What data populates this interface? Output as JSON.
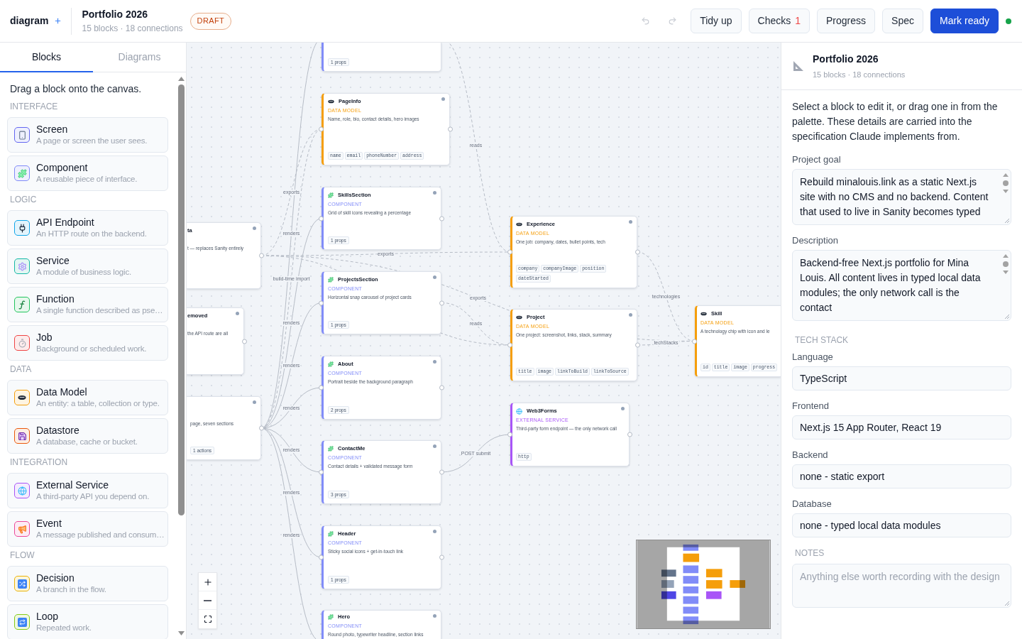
{
  "header": {
    "app": "diagram",
    "title": "Portfolio 2026",
    "subtitle": "15 blocks · 18 connections",
    "status": "DRAFT",
    "undo": {
      "disabled": true
    },
    "redo": {
      "disabled": true
    },
    "actions": [
      {
        "label": "Tidy up",
        "kind": "secondary"
      },
      {
        "label": "Checks",
        "count": "1",
        "kind": "secondary"
      },
      {
        "label": "Progress",
        "kind": "secondary"
      },
      {
        "label": "Spec",
        "kind": "secondary"
      },
      {
        "label": "Mark ready",
        "kind": "primary"
      }
    ],
    "connected": true
  },
  "sidebar": {
    "tabs": [
      {
        "label": "Blocks",
        "selected": true
      },
      {
        "label": "Diagrams",
        "selected": false
      }
    ],
    "hint": "Drag a block onto the canvas.",
    "sections": [
      {
        "label": "INTERFACE",
        "items": [
          {
            "kind": "screen",
            "title": "Screen",
            "description": "A page or screen the user sees."
          },
          {
            "kind": "component",
            "title": "Component",
            "description": "A reusable piece of interface."
          }
        ]
      },
      {
        "label": "LOGIC",
        "items": [
          {
            "kind": "api",
            "title": "API Endpoint",
            "description": "An HTTP route on the backend."
          },
          {
            "kind": "service",
            "title": "Service",
            "description": "A module of business logic."
          },
          {
            "kind": "function",
            "title": "Function",
            "description": "A single function described as pse…"
          },
          {
            "kind": "job",
            "title": "Job",
            "description": "Background or scheduled work."
          }
        ]
      },
      {
        "label": "DATA",
        "items": [
          {
            "kind": "data_model",
            "title": "Data Model",
            "description": "An entity: a table, collection or type."
          },
          {
            "kind": "datastore",
            "title": "Datastore",
            "description": "A database, cache or bucket."
          }
        ]
      },
      {
        "label": "INTEGRATION",
        "items": [
          {
            "kind": "external_service",
            "title": "External Service",
            "description": "A third-party API you depend on."
          },
          {
            "kind": "event",
            "title": "Event",
            "description": "A message published and consum…"
          }
        ]
      },
      {
        "label": "FLOW",
        "items": [
          {
            "kind": "decision",
            "title": "Decision",
            "description": "A branch in the flow."
          },
          {
            "kind": "loop",
            "title": "Loop",
            "description": "Repeated work."
          }
        ]
      }
    ]
  },
  "canvas": {
    "nodes": [
      {
        "kind": "component",
        "tags": [
          "1 props"
        ]
      },
      {
        "kind": "data_model",
        "title": "PageInfo",
        "type_label": "DATA MODEL",
        "description": "Name, role, bio, contact details, hero images",
        "fields": [
          "name",
          "email",
          "phoneNumber",
          "address"
        ]
      },
      {
        "title": "ta",
        "description": "t — replaces Sanity entirely"
      },
      {
        "kind": "component",
        "title": "SkillsSection",
        "type_label": "COMPONENT",
        "description": "Grid of skill icons revealing a percentage",
        "tags": [
          "1 props"
        ]
      },
      {
        "kind": "component",
        "title": "ProjectsSection",
        "type_label": "COMPONENT",
        "description": "Horizontal snap carousel of project cards",
        "tags": [
          "1 props"
        ]
      },
      {
        "title": "emoved",
        "description": "the API route are all"
      },
      {
        "kind": "component",
        "title": "About",
        "type_label": "COMPONENT",
        "description": "Portrait beside the background paragraph",
        "tags": [
          "2 props"
        ]
      },
      {
        "description": "page, seven sections",
        "tags": [
          "1 actions"
        ]
      },
      {
        "kind": "component",
        "title": "ContactMe",
        "type_label": "COMPONENT",
        "description": "Contact details + validated message form",
        "tags": [
          "3 props"
        ]
      },
      {
        "kind": "component",
        "title": "Header",
        "type_label": "COMPONENT",
        "description": "Sticky social icons + get-in-touch link",
        "tags": [
          "1 props"
        ]
      },
      {
        "kind": "component",
        "title": "Hero",
        "type_label": "COMPONENT",
        "description": "Round photo, typewriter headline, section links"
      },
      {
        "kind": "data_model",
        "title": "Experience",
        "type_label": "DATA MODEL",
        "description": "One job: company, dates, bullet points, tech",
        "fields": [
          "company",
          "companyImage",
          "position",
          "dateStarted"
        ]
      },
      {
        "kind": "data_model",
        "title": "Project",
        "type_label": "DATA MODEL",
        "description": "One project: screenshot, links, stack, summary",
        "fields": [
          "title",
          "image",
          "linkToBuild",
          "linkToSource"
        ]
      },
      {
        "kind": "external_service",
        "title": "Web3Forms",
        "type_label": "EXTERNAL SERVICE",
        "description": "Third-party form endpoint — the only network call",
        "fields": [
          "http"
        ]
      },
      {
        "kind": "data_model",
        "title": "Skill",
        "type_label": "DATA MODEL",
        "description": "A technology chip with icon and le",
        "fields": [
          "id",
          "title",
          "image",
          "progress"
        ]
      }
    ],
    "edges": [
      {
        "label": "reads",
        "kind": "dashed"
      },
      {
        "label": "exports",
        "kind": "dashed"
      },
      {
        "label": "renders",
        "kind": "solid"
      },
      {
        "label": "exports",
        "kind": "dashed"
      },
      {
        "label": "build-time import",
        "kind": "dashed"
      },
      {
        "label": "exports",
        "kind": "dashed"
      },
      {
        "label": "technologies",
        "kind": "dashed"
      },
      {
        "label": "renders",
        "kind": "solid"
      },
      {
        "label": "reads",
        "kind": "dashed"
      },
      {
        "label": "techStacks",
        "kind": "dashed"
      },
      {
        "label": "renders",
        "kind": "solid"
      },
      {
        "label": "renders",
        "kind": "solid"
      },
      {
        "label": "renders",
        "kind": "solid"
      },
      {
        "label": "POST submit",
        "kind": "solid"
      },
      {
        "label": "renders",
        "kind": "solid"
      },
      {
        "label": "renders",
        "kind": "solid"
      },
      {
        "kind": "dashed"
      }
    ]
  },
  "inspector": {
    "title": "Portfolio 2026",
    "subtitle": "15 blocks · 18 connections",
    "intro": "Select a block to edit it, or drag one in from the palette. These details are carried into the specification Claude implements from.",
    "items": [
      {
        "kind": "textarea",
        "label": "Project goal",
        "value": "Rebuild minalouis.link as a static Next.js site with no CMS and no backend. Content that used to live in Sanity becomes typed"
      },
      {
        "kind": "textarea",
        "label": "Description",
        "value": "Backend-free Next.js portfolio for Mina Louis. All content lives in typed local data modules; the only network call is the contact"
      },
      {
        "kind": "heading",
        "text": "TECH STACK"
      },
      {
        "kind": "input",
        "label": "Language",
        "value": "TypeScript"
      },
      {
        "kind": "input",
        "label": "Frontend",
        "value": "Next.js 15 App Router, React 19"
      },
      {
        "kind": "input",
        "label": "Backend",
        "value": "none - static export"
      },
      {
        "kind": "input",
        "label": "Database",
        "value": "none - typed local data modules"
      },
      {
        "kind": "heading",
        "text": "NOTES"
      },
      {
        "kind": "textarea",
        "placeholder": "Anything else worth recording with the design"
      }
    ]
  }
}
